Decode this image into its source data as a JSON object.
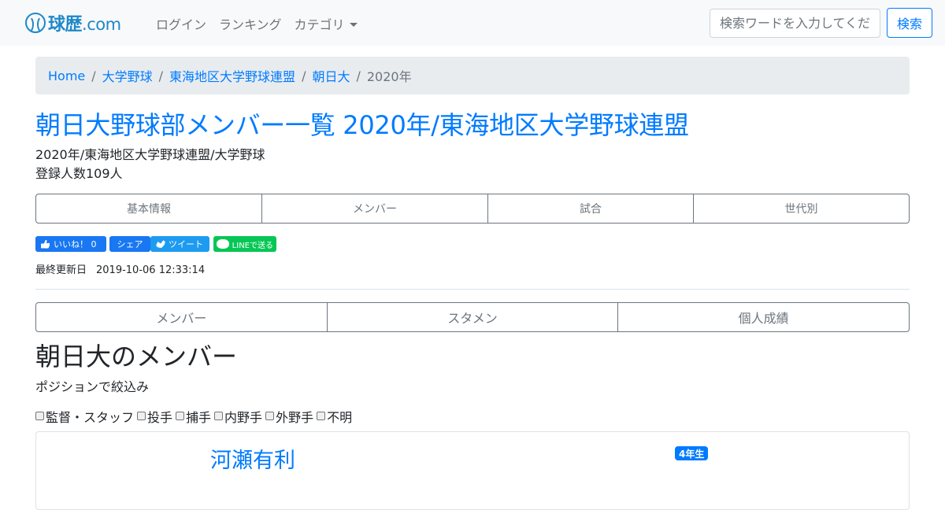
{
  "header": {
    "brand_main": "球歴",
    "brand_suffix": ".com",
    "nav": {
      "login": "ログイン",
      "ranking": "ランキング",
      "category": "カテゴリ"
    },
    "search": {
      "placeholder": "検索ワードを入力してください",
      "button": "検索"
    }
  },
  "breadcrumb": {
    "items": [
      "Home",
      "大学野球",
      "東海地区大学野球連盟",
      "朝日大"
    ],
    "current": "2020年"
  },
  "page": {
    "title": "朝日大野球部メンバー一覧 2020年/東海地区大学野球連盟",
    "subtitle": "2020年/東海地区大学野球連盟/大学野球",
    "member_count": "登録人数109人"
  },
  "tabs1": [
    "基本情報",
    "メンバー",
    "試合",
    "世代別"
  ],
  "social": {
    "like": "いいね！ 0",
    "share": "シェア",
    "tweet": "ツイート",
    "line": "LINEで送る"
  },
  "last_updated": {
    "label": "最終更新日",
    "value": "2019-10-06 12:33:14"
  },
  "tabs2": [
    "メンバー",
    "スタメン",
    "個人成績"
  ],
  "members": {
    "title": "朝日大のメンバー",
    "filter_label": "ポジションで絞込み",
    "filters": [
      "監督・スタッフ",
      "投手",
      "捕手",
      "内野手",
      "外野手",
      "不明"
    ]
  },
  "player": {
    "name": "河瀬有利",
    "grade": "4年生"
  },
  "colors": {
    "link": "#007bff",
    "brand": "#1e88c8",
    "facebook": "#1877f2",
    "twitter": "#1d9bf0",
    "line": "#06c755"
  }
}
